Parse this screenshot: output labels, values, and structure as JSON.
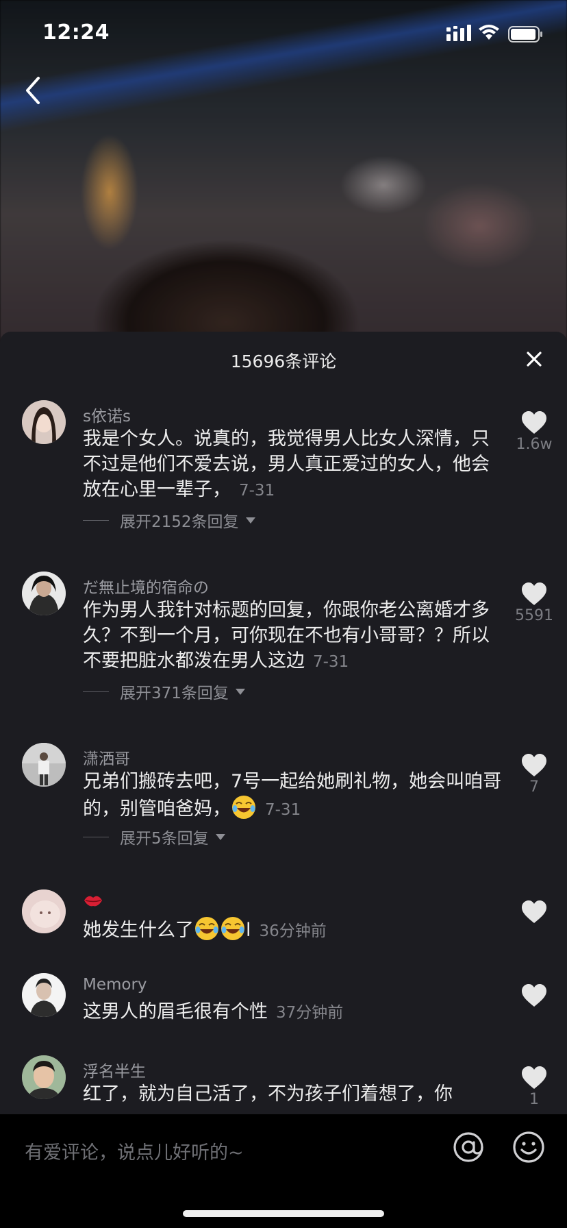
{
  "status_bar": {
    "time": "12:24"
  },
  "panel": {
    "title": "15696条评论"
  },
  "comments": [
    {
      "author": "s依诺s",
      "text": "我是个女人。说真的，我觉得男人比女人深情，只不过是他们不爱去说，男人真正爱过的女人，他会放在心里一辈子，",
      "date": "7-31",
      "likes": "1.6w",
      "expand": "展开2152条回复"
    },
    {
      "author": "だ無止境的宿命の",
      "text": "作为男人我针对标题的回复，你跟你老公离婚才多久？不到一个月，可你现在不也有小哥哥？？所以不要把脏水都泼在男人这边",
      "date": "7-31",
      "likes": "5591",
      "expand": "展开371条回复"
    },
    {
      "author": "潇洒哥",
      "text": "兄弟们搬砖去吧，7号一起给她刷礼物，她会叫咱哥的，别管咱爸妈，",
      "date": "7-31",
      "likes": "7",
      "expand": "展开5条回复"
    },
    {
      "author": "",
      "text": "她发生什么了",
      "text_suffix": "l",
      "date": "36分钟前",
      "likes": ""
    },
    {
      "author": "Memory",
      "text": "这男人的眉毛很有个性",
      "date": "37分钟前",
      "likes": ""
    },
    {
      "author": "浮名半生",
      "text": "红了，就为自己活了，不为孩子们着想了，你",
      "date": "",
      "likes": "1"
    }
  ],
  "input": {
    "placeholder": "有爱评论，说点儿好听的~"
  },
  "icons": {
    "back": "chevron-left-icon",
    "close": "close-icon",
    "like": "heart-icon",
    "at": "at-sign-icon",
    "emoji": "smiley-icon",
    "lips": "lips-icon",
    "laugh": "laughing-tears-emoji"
  },
  "colors": {
    "panel_bg": "#1c1c21",
    "text_primary": "#ededed",
    "text_secondary": "#9a9ba1",
    "heart": "#e6e6e6"
  }
}
